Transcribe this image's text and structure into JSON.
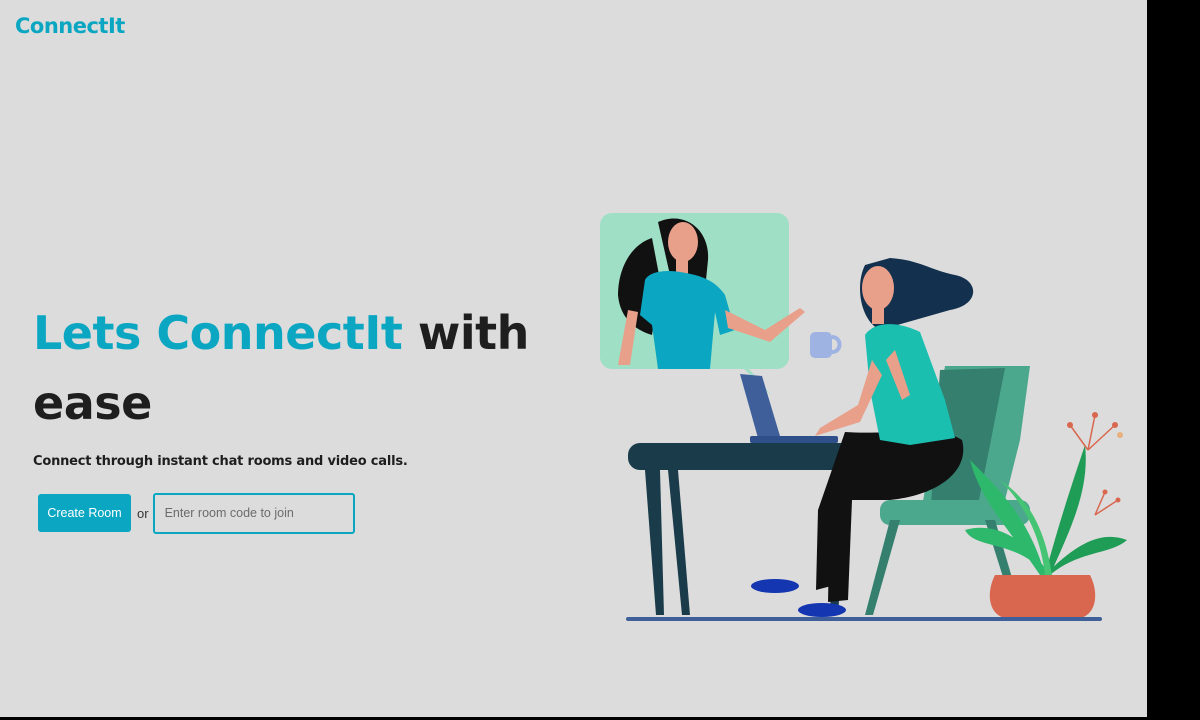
{
  "header": {
    "logo": "ConnectIt"
  },
  "hero": {
    "title_accent": "Lets ConnectIt",
    "title_rest": "with ease",
    "subtitle": "Connect through instant chat rooms and video calls."
  },
  "actions": {
    "create_label": "Create Room",
    "or_label": "or",
    "join_placeholder": "Enter room code to join"
  },
  "colors": {
    "accent": "#0aa6c2",
    "background": "#dcdcdc",
    "text": "#1e1e1e"
  },
  "illustration": {
    "icon": "video-call-illustration"
  }
}
